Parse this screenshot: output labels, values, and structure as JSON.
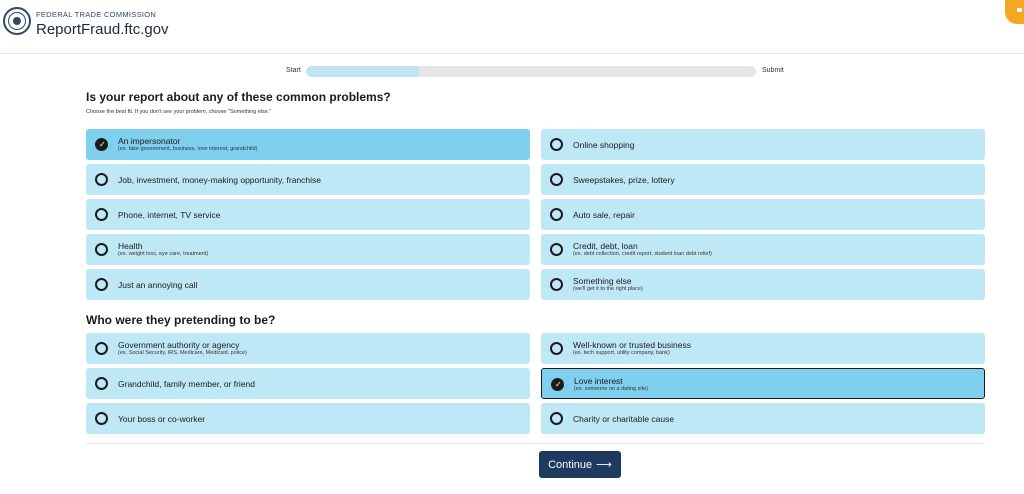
{
  "header": {
    "agency": "FEDERAL TRADE COMMISSION",
    "site": "ReportFraud.ftc.gov",
    "seal_icon": "ftc-seal-icon",
    "chat_icon": "chat-bubble-icon"
  },
  "progress": {
    "start_label": "Start",
    "end_label": "Submit",
    "fraction": 0.25
  },
  "section1": {
    "title": "Is your report about any of these common problems?",
    "subtitle": "Choose the best fit. If you don't see your problem, choose \"Something else.\"",
    "options": [
      {
        "label": "An impersonator",
        "desc": "(ex. fake government, business, love interest, grandchild)",
        "selected": true
      },
      {
        "label": "Online shopping",
        "desc": "",
        "selected": false
      },
      {
        "label": "Job, investment, money-making opportunity, franchise",
        "desc": "",
        "selected": false
      },
      {
        "label": "Sweepstakes, prize, lottery",
        "desc": "",
        "selected": false
      },
      {
        "label": "Phone, internet, TV service",
        "desc": "",
        "selected": false
      },
      {
        "label": "Auto sale, repair",
        "desc": "",
        "selected": false
      },
      {
        "label": "Health",
        "desc": "(ex. weight loss, eye care, treatment)",
        "selected": false
      },
      {
        "label": "Credit, debt, loan",
        "desc": "(ex. debt collection, credit report, student loan debt relief)",
        "selected": false
      },
      {
        "label": "Just an annoying call",
        "desc": "",
        "selected": false
      },
      {
        "label": "Something else",
        "desc": "(we'll get it to the right place)",
        "selected": false
      }
    ]
  },
  "section2": {
    "title": "Who were they pretending to be?",
    "options": [
      {
        "label": "Government authority or agency",
        "desc": "(ex. Social Security, IRS, Medicare, Medicaid, police)",
        "selected": false
      },
      {
        "label": "Well-known or trusted business",
        "desc": "(ex. tech support, utility company, bank)",
        "selected": false
      },
      {
        "label": "Grandchild, family member, or friend",
        "desc": "",
        "selected": false
      },
      {
        "label": "Love interest",
        "desc": "(ex. someone on a dating site)",
        "selected": true
      },
      {
        "label": "Your boss or co-worker",
        "desc": "",
        "selected": false
      },
      {
        "label": "Charity or charitable cause",
        "desc": "",
        "selected": false
      }
    ]
  },
  "continue_label": "Continue",
  "colors": {
    "option_bg": "#bfe8f7",
    "option_selected_bg": "#7fcfee",
    "button_bg": "#1e3a5f",
    "accent_chat": "#f5a623"
  }
}
